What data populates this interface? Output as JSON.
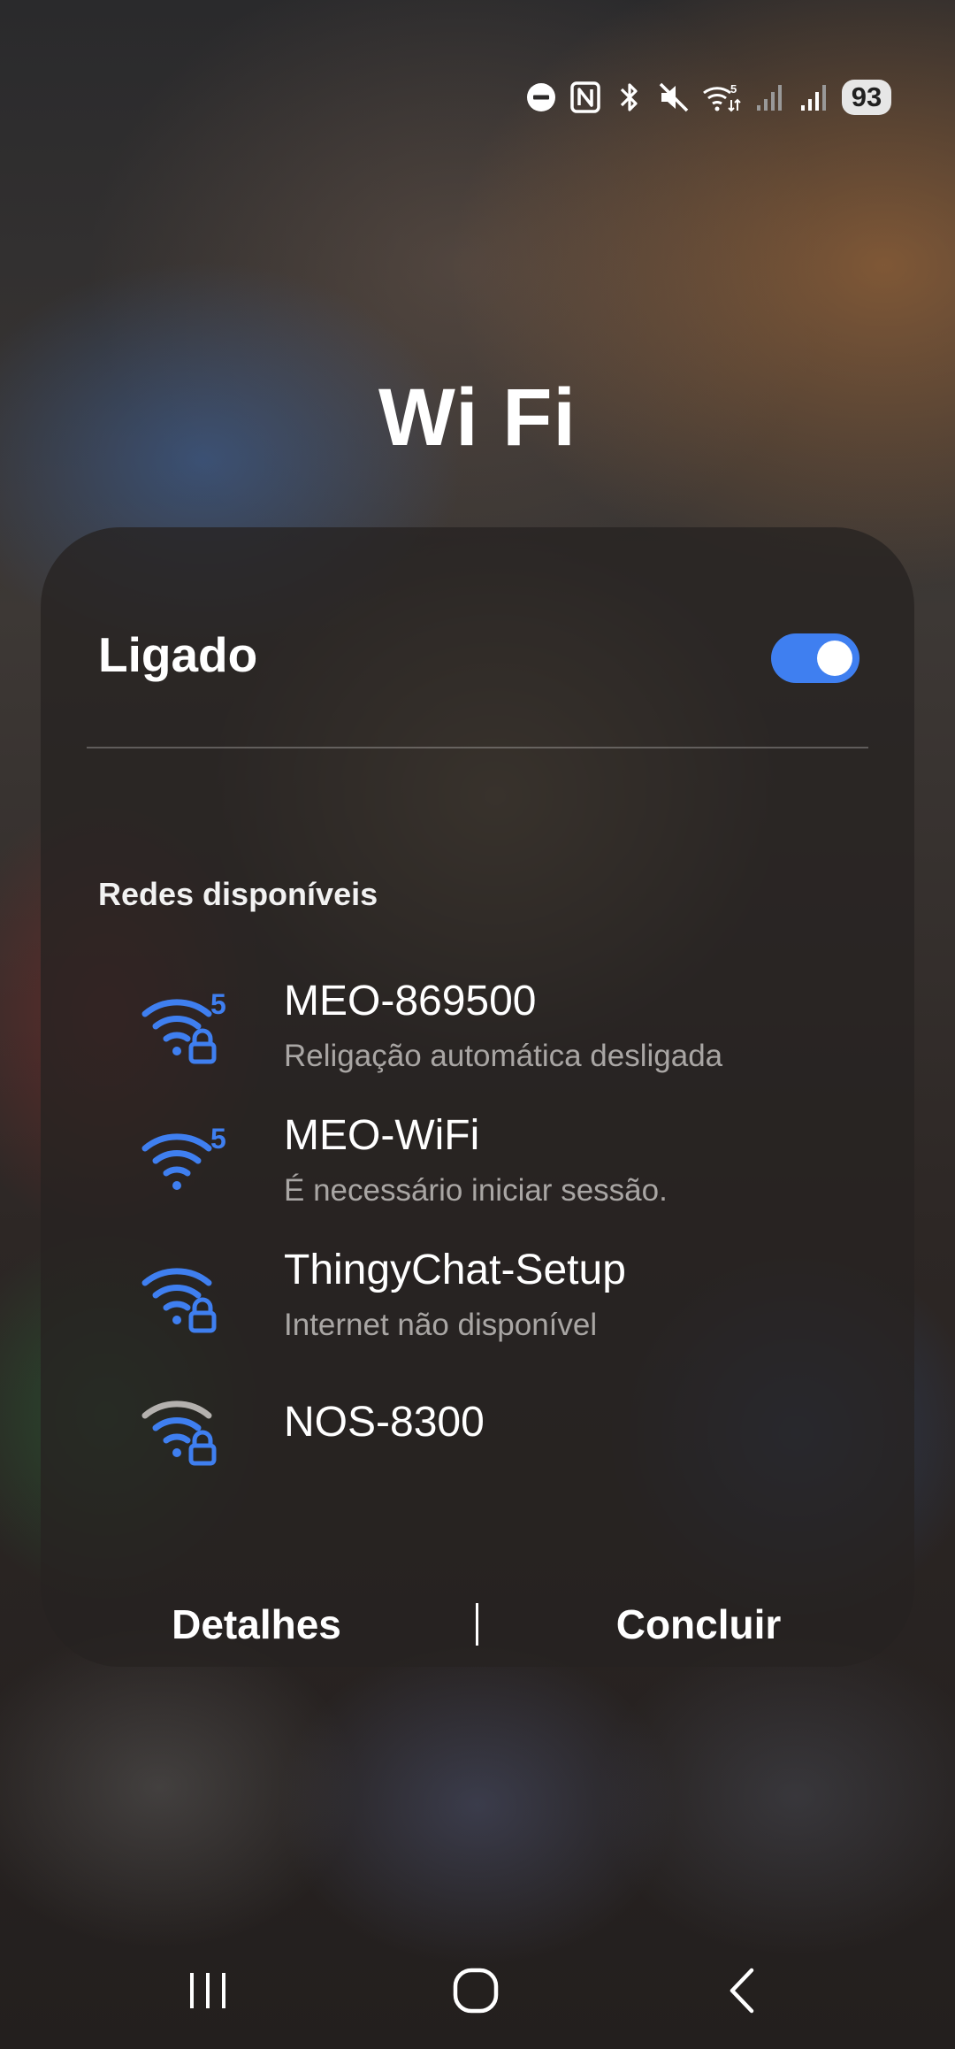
{
  "status_bar": {
    "icons": [
      "dnd-icon",
      "nfc-icon",
      "bluetooth-icon",
      "mute-icon",
      "wifi-5g-icon",
      "signal-icon",
      "signal-icon"
    ],
    "battery": "93"
  },
  "title": "Wi Fi",
  "toggle": {
    "label": "Ligado",
    "on": true,
    "color": "#3f7ff0"
  },
  "section_header": "Redes disponíveis",
  "networks": [
    {
      "name": "MEO-869500",
      "subtitle": "Religação automática desligada",
      "band": "5",
      "locked": true,
      "icon_color": "#3f7ff0"
    },
    {
      "name": "MEO-WiFi",
      "subtitle": "É necessário iniciar sessão.",
      "band": "5",
      "locked": false,
      "icon_color": "#3f7ff0"
    },
    {
      "name": "ThingyChat-Setup",
      "subtitle": "Internet não disponível",
      "band": "",
      "locked": true,
      "icon_color": "#3f7ff0"
    },
    {
      "name": "NOS-8300",
      "subtitle": "",
      "band": "",
      "locked": true,
      "icon_color": "#3f7ff0",
      "weak_signal": true
    }
  ],
  "actions": {
    "details": "Detalhes",
    "done": "Concluir"
  },
  "nav": [
    "recents-icon",
    "home-icon",
    "back-icon"
  ]
}
